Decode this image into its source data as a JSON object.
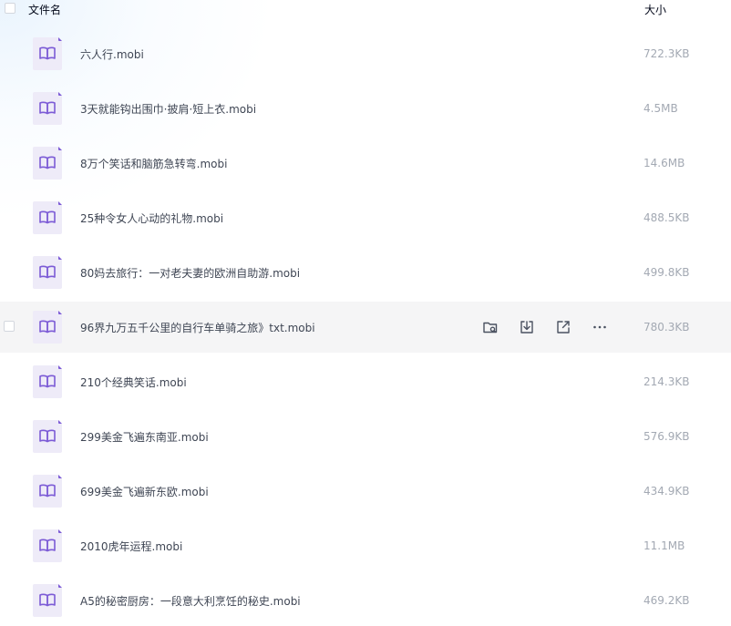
{
  "header": {
    "name_label": "文件名",
    "size_label": "大小"
  },
  "hovered_actions": [
    "folder-link-icon",
    "download-icon",
    "share-icon",
    "more-icon"
  ],
  "colors": {
    "icon_accent": "#7c5bd6",
    "hover_row": "#f5f5f6",
    "size_text": "#a3a9b3"
  },
  "files": [
    {
      "name": "六人行.mobi",
      "size": "722.3KB"
    },
    {
      "name": "3天就能钩出围巾·披肩·短上衣.mobi",
      "size": "4.5MB"
    },
    {
      "name": "8万个笑话和脑筋急转弯.mobi",
      "size": "14.6MB"
    },
    {
      "name": "25种令女人心动的礼物.mobi",
      "size": "488.5KB"
    },
    {
      "name": "80妈去旅行：一对老夫妻的欧洲自助游.mobi",
      "size": "499.8KB"
    },
    {
      "name": "96界九万五千公里的自行车单骑之旅》txt.mobi",
      "size": "780.3KB"
    },
    {
      "name": "210个经典笑话.mobi",
      "size": "214.3KB"
    },
    {
      "name": "299美金飞遍东南亚.mobi",
      "size": "576.9KB"
    },
    {
      "name": "699美金飞遍新东欧.mobi",
      "size": "434.9KB"
    },
    {
      "name": "2010虎年运程.mobi",
      "size": "11.1MB"
    },
    {
      "name": "A5的秘密厨房：一段意大利烹饪的秘史.mobi",
      "size": "469.2KB"
    }
  ]
}
